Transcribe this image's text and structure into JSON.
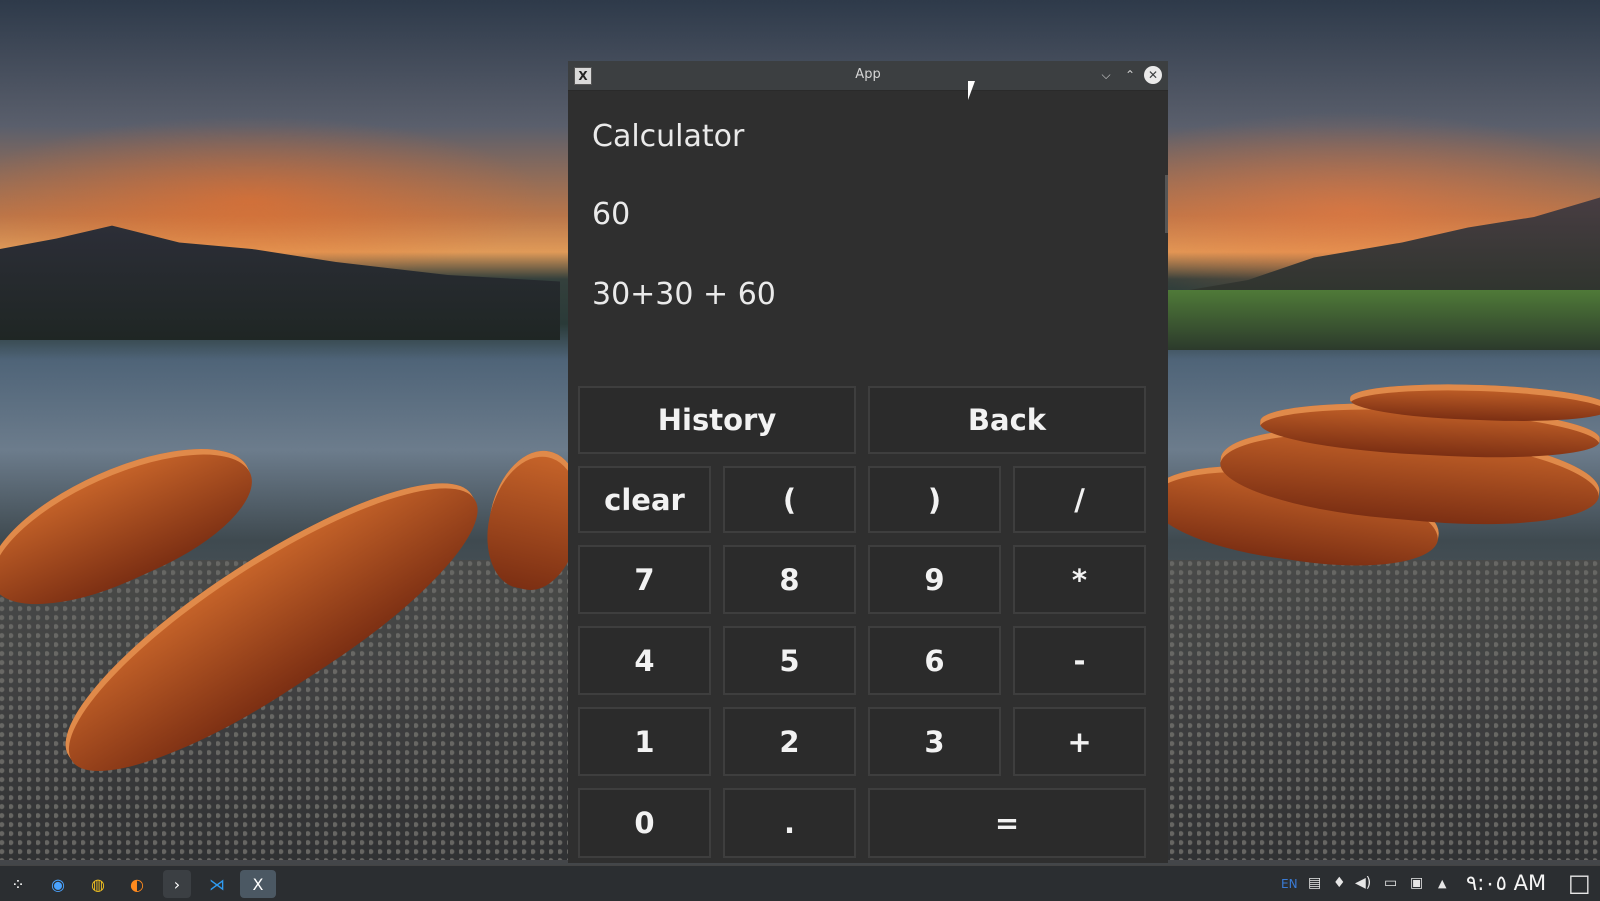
{
  "window": {
    "title": "App",
    "app_icon": "X",
    "minimize_icon": "⌵",
    "maximize_icon": "⌃",
    "close_icon": "✕"
  },
  "calculator": {
    "heading": "Calculator",
    "result": "60",
    "expression": "30+30 + 60"
  },
  "buttons": {
    "history": "History",
    "back": "Back",
    "clear": "clear",
    "open_paren": "(",
    "close_paren": ")",
    "divide": "/",
    "seven": "7",
    "eight": "8",
    "nine": "9",
    "multiply": "*",
    "four": "4",
    "five": "5",
    "six": "6",
    "minus": "-",
    "one": "1",
    "two": "2",
    "three": "3",
    "plus": "+",
    "zero": "0",
    "dot": ".",
    "equals": "="
  },
  "taskbar": {
    "app_menu_icon": "⁘",
    "browser1_icon": "◉",
    "chrome_icon": "◍",
    "firefox_icon": "◐",
    "terminal_icon": "›",
    "vscode_icon": "⋊",
    "active_app_icon": "X",
    "language": "EN",
    "clipboard_icon": "▤",
    "bulb_icon": "♦",
    "volume_icon": "◀)",
    "battery_icon": "▭",
    "network_icon": "▣",
    "tray_expand_icon": "▲",
    "clock": "٩:٠٥ AM",
    "desktop_icon": "□"
  }
}
